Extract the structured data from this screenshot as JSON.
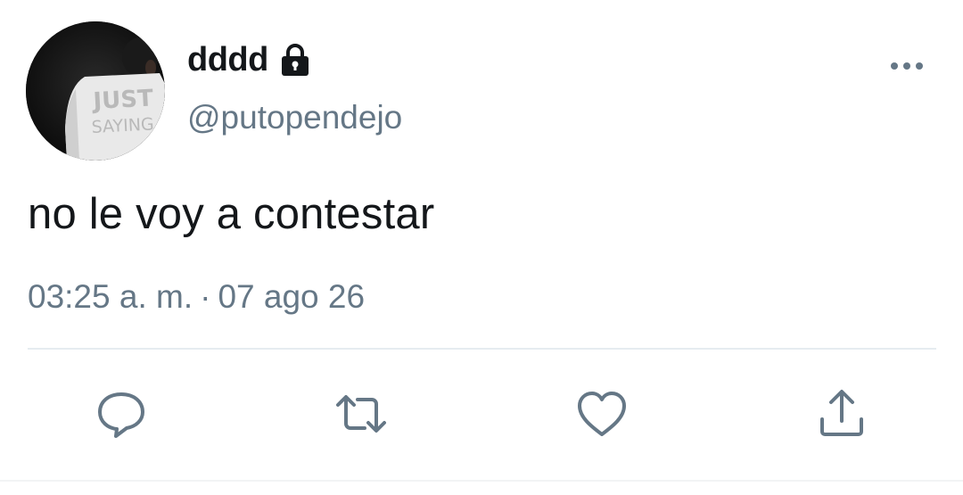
{
  "user": {
    "display_name": "dddd",
    "handle": "@putopendejo",
    "protected_icon": "lock-icon",
    "avatar_shirt_text_line1": "JUST",
    "avatar_shirt_text_line2": "SAYING"
  },
  "tweet": {
    "text": "no le voy a contestar",
    "time": "03:25 a. m.",
    "separator": "·",
    "date": "07 ago 26"
  },
  "actions": [
    {
      "name": "reply",
      "icon": "reply-icon"
    },
    {
      "name": "retweet",
      "icon": "retweet-icon"
    },
    {
      "name": "like",
      "icon": "heart-icon"
    },
    {
      "name": "share",
      "icon": "share-icon"
    }
  ],
  "colors": {
    "primary_text": "#14171a",
    "secondary_text": "#657786",
    "divider": "#e6ecf0",
    "icon": "#657786"
  }
}
